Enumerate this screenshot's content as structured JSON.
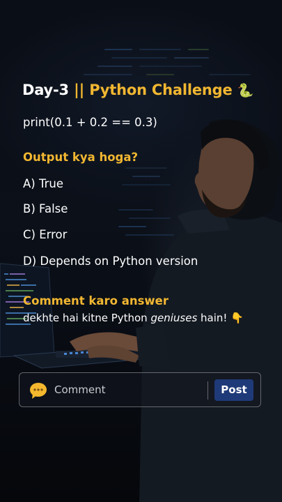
{
  "post": {
    "title_prefix": "Day-3",
    "title_separator": "||",
    "title_main": "Python Challenge",
    "title_emoji": "🐍",
    "code": "print(0.1 + 0.2 == 0.3)",
    "question": "Output kya hoga?",
    "options": [
      {
        "letter": "A)",
        "text": "True"
      },
      {
        "letter": "B)",
        "text": "False"
      },
      {
        "letter": "C)",
        "text": "Error"
      },
      {
        "letter": "D)",
        "text": "Depends on Python version"
      }
    ],
    "cta_title": "Comment karo answer",
    "cta_text_before": "dekhte hai kitne Python ",
    "cta_text_italic": "geniuses",
    "cta_text_after": " hain! 👇"
  },
  "comment_bar": {
    "placeholder": "Comment",
    "post_label": "Post",
    "emoji_icon": "speech-bubble-emoji-icon"
  },
  "colors": {
    "accent": "#f2b731",
    "text": "#ffffff",
    "background": "#0a0e16",
    "post_button": "#1f3a78"
  }
}
